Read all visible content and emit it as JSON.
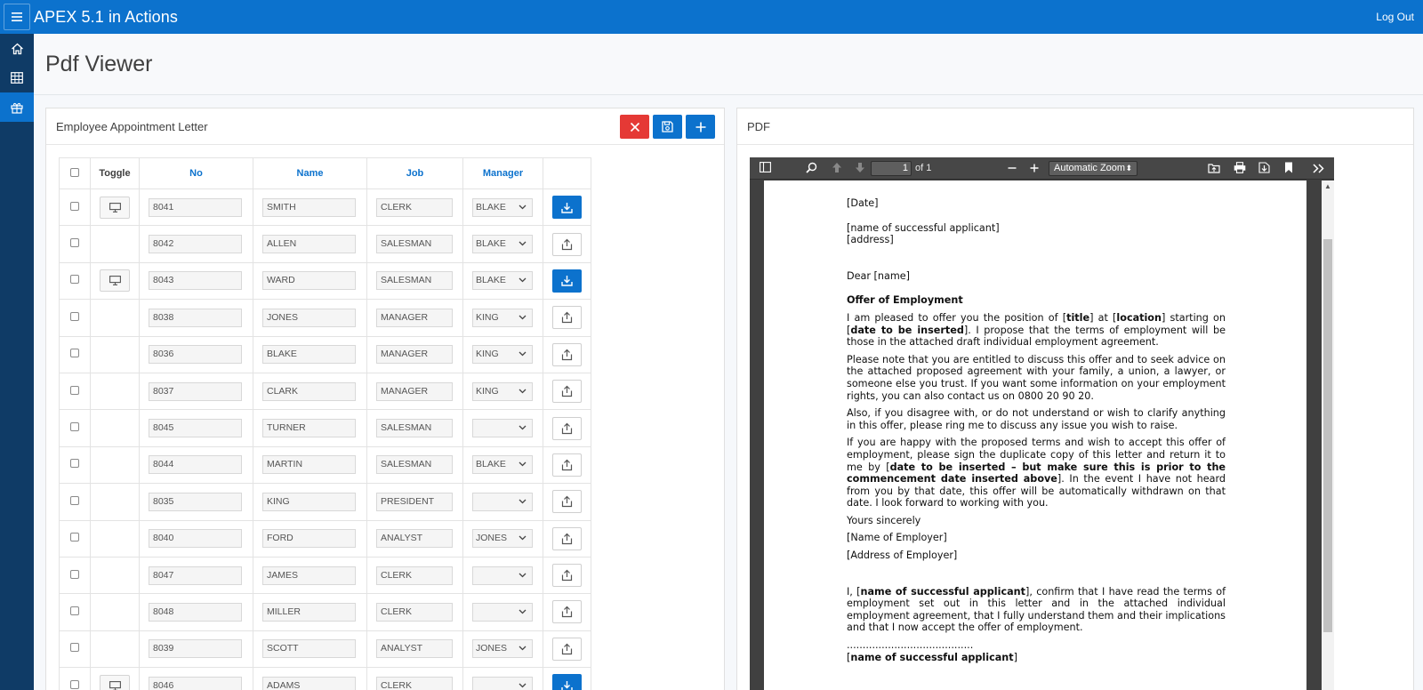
{
  "app": {
    "title": "APEX 5.1 in Actions",
    "logout_label": "Log Out"
  },
  "nav": [
    {
      "name": "home",
      "icon": "home-icon"
    },
    {
      "name": "table",
      "icon": "table-icon"
    },
    {
      "name": "gift",
      "icon": "gift-icon",
      "active": true
    }
  ],
  "page": {
    "title": "Pdf Viewer"
  },
  "left_region": {
    "title": "Employee Appointment Letter",
    "buttons": [
      "close-icon",
      "save-icon",
      "plus-icon"
    ],
    "columns": {
      "toggle": "Toggle",
      "no": "No",
      "name": "Name",
      "job": "Job",
      "manager": "Manager"
    },
    "rows": [
      {
        "no": "8041",
        "name": "SMITH",
        "job": "CLERK",
        "manager": "BLAKE",
        "toggle": true,
        "action": "download"
      },
      {
        "no": "8042",
        "name": "ALLEN",
        "job": "SALESMAN",
        "manager": "BLAKE",
        "toggle": false,
        "action": "upload"
      },
      {
        "no": "8043",
        "name": "WARD",
        "job": "SALESMAN",
        "manager": "BLAKE",
        "toggle": true,
        "action": "download"
      },
      {
        "no": "8038",
        "name": "JONES",
        "job": "MANAGER",
        "manager": "KING",
        "toggle": false,
        "action": "upload"
      },
      {
        "no": "8036",
        "name": "BLAKE",
        "job": "MANAGER",
        "manager": "KING",
        "toggle": false,
        "action": "upload"
      },
      {
        "no": "8037",
        "name": "CLARK",
        "job": "MANAGER",
        "manager": "KING",
        "toggle": false,
        "action": "upload"
      },
      {
        "no": "8045",
        "name": "TURNER",
        "job": "SALESMAN",
        "manager": "",
        "toggle": false,
        "action": "upload"
      },
      {
        "no": "8044",
        "name": "MARTIN",
        "job": "SALESMAN",
        "manager": "BLAKE",
        "toggle": false,
        "action": "upload"
      },
      {
        "no": "8035",
        "name": "KING",
        "job": "PRESIDENT",
        "manager": "",
        "toggle": false,
        "action": "upload"
      },
      {
        "no": "8040",
        "name": "FORD",
        "job": "ANALYST",
        "manager": "JONES",
        "toggle": false,
        "action": "upload"
      },
      {
        "no": "8047",
        "name": "JAMES",
        "job": "CLERK",
        "manager": "",
        "toggle": false,
        "action": "upload"
      },
      {
        "no": "8048",
        "name": "MILLER",
        "job": "CLERK",
        "manager": "",
        "toggle": false,
        "action": "upload"
      },
      {
        "no": "8039",
        "name": "SCOTT",
        "job": "ANALYST",
        "manager": "JONES",
        "toggle": false,
        "action": "upload"
      },
      {
        "no": "8046",
        "name": "ADAMS",
        "job": "CLERK",
        "manager": "",
        "toggle": true,
        "action": "download"
      }
    ]
  },
  "right_region": {
    "title": "PDF",
    "toolbar": {
      "page_value": "1",
      "page_of": "of 1",
      "zoom": "Automatic Zoom"
    },
    "letter": {
      "date": "[Date]",
      "applicant_name": "[name of successful applicant]",
      "address": "[address]",
      "greeting": "Dear [name]",
      "heading": "Offer of Employment",
      "p1_a": "I am pleased to offer you the position of [",
      "p1_title": "title",
      "p1_b": "] at [",
      "p1_location": "location",
      "p1_c": "] starting on [",
      "p1_date": "date to be inserted",
      "p1_d": "].  I propose that the terms of employment will be those in the attached draft individual employment agreement.",
      "p2": "Please note that you are entitled to discuss this offer and to seek advice on the attached proposed agreement with your family, a union, a lawyer, or someone else you trust.  If you want some information on your employment rights, you can also contact us on 0800 20 90 20.",
      "p3": "Also, if you disagree with, or do not understand or wish to clarify anything in this offer, please ring me to discuss any issue you wish to raise.",
      "p4_a": "If you are happy with the proposed terms and wish to accept this offer of employment, please sign the duplicate copy of this letter and return it to me by [",
      "p4_bold": "date to be inserted – but make sure this is prior to the commencement date inserted above",
      "p4_b": "].  In the event I have not heard from you by that date, this offer will be automatically withdrawn on that date.  I look forward to working with you.",
      "closing": "Yours sincerely",
      "employer_name": "[Name of Employer]",
      "employer_address": "[Address of Employer]",
      "p5_a": "I, [",
      "p5_bold": "name of successful applicant",
      "p5_b": "], confirm that I have read the terms of employment set out in this letter and in the attached individual employment agreement, that I fully understand them and their implications and that I now accept the offer of employment.",
      "dots": "........................................",
      "sign_open": "[",
      "sign_bold": "name of successful applicant",
      "sign_close": "]"
    }
  }
}
